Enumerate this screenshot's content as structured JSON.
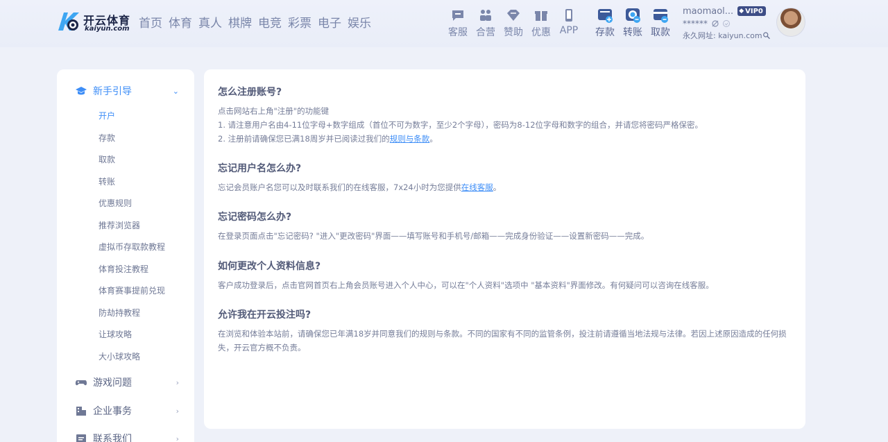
{
  "logo": {
    "name": "开云体育",
    "sub": "kaiyun.com"
  },
  "nav": [
    "首页",
    "体育",
    "真人",
    "棋牌",
    "电竞",
    "彩票",
    "电子",
    "娱乐"
  ],
  "tools": [
    {
      "label": "客服",
      "icon": "chat-icon"
    },
    {
      "label": "合营",
      "icon": "partner-icon"
    },
    {
      "label": "赞助",
      "icon": "diamond-icon"
    },
    {
      "label": "优惠",
      "icon": "gift-icon"
    },
    {
      "label": "APP",
      "icon": "phone-icon"
    }
  ],
  "funds": [
    {
      "label": "存款",
      "icon": "deposit-icon"
    },
    {
      "label": "转账",
      "icon": "transfer-icon"
    },
    {
      "label": "取款",
      "icon": "withdraw-icon"
    }
  ],
  "user": {
    "username": "maomaol...",
    "vip": "VIP0",
    "balance": "******",
    "url": "永久网址: kaiyun.com"
  },
  "sidebar": {
    "guide": {
      "title": "新手引导",
      "items": [
        "开户",
        "存款",
        "取款",
        "转账",
        "优惠规则",
        "推荐浏览器",
        "虚拟币存取款教程",
        "体育投注教程",
        "体育赛事提前兑现",
        "防劫持教程",
        "让球攻略",
        "大小球攻略"
      ]
    },
    "games": "游戏问题",
    "corp": "企业事务",
    "contact": "联系我们"
  },
  "faq": [
    {
      "q": "怎么注册账号?",
      "lines": [
        "点击网站右上角\"注册\"的功能键",
        "1. 请注意用户名由4-11位字母+数字组成（首位不可为数字，至少2个字母），密码为8-12位字母和数字的组合，并请您将密码严格保密。"
      ],
      "line3_pre": "2. 注册前请确保您已满18周岁并已阅读过我们的",
      "line3_link": "规则与条款",
      "line3_post": "。"
    },
    {
      "q": "忘记用户名怎么办?",
      "pre": "忘记会员账户名您可以及时联系我们的在线客服，7x24小时为您提供",
      "link": "在线客服",
      "post": "。"
    },
    {
      "q": "忘记密码怎么办?",
      "text": "在登录页面点击\"忘记密码? \"进入\"更改密码\"界面——填写账号和手机号/邮箱——完成身份验证——设置新密码——完成。"
    },
    {
      "q": "如何更改个人资料信息?",
      "text": "客户成功登录后，点击官网首页右上角会员账号进入个人中心，可以在\"个人资料\"选项中 \"基本资料\"界面修改。有何疑问可以咨询在线客服。"
    },
    {
      "q": "允许我在开云投注吗?",
      "text": "在浏览和体验本站前，请确保您已年满18岁并同意我们的规则与条款。不同的国家有不同的监管条例，投注前请遵循当地法规与法律。若因上述原因造成的任何损失，开云官方概不负责。"
    }
  ],
  "colors": {
    "accent": "#3e8ef7",
    "page_bg": "#eef1f9",
    "panel_bg": "#ffffff",
    "fund_icon": "#3d5a99"
  }
}
